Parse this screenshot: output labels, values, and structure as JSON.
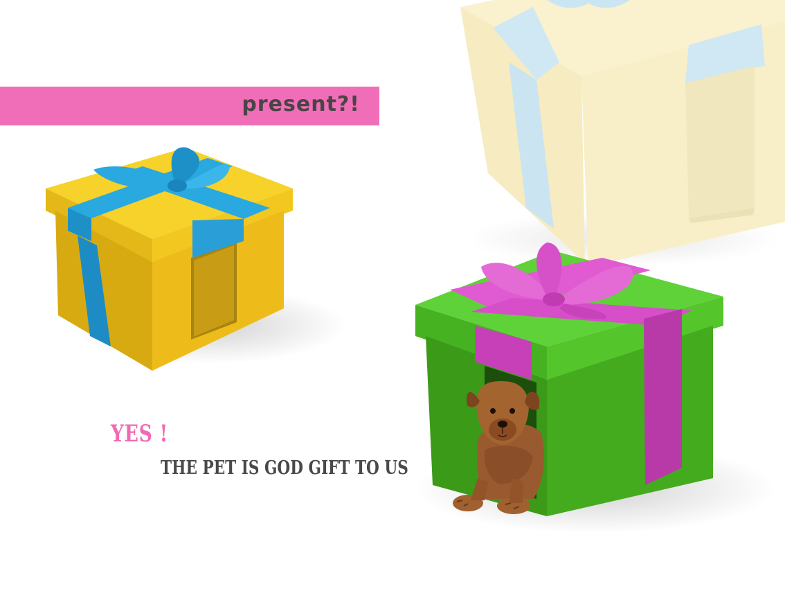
{
  "banner": {
    "text": "present?!",
    "color": "#f06eb8"
  },
  "headline": {
    "text": "YES !",
    "color": "#f16ab4"
  },
  "tagline": {
    "text": "THE PET IS GOD GIFT TO US",
    "color": "#4a4848"
  },
  "gift_boxes": [
    {
      "name": "yellow-gift-box",
      "box_color": "#f2c820",
      "ribbon_color": "#2aa8e0"
    },
    {
      "name": "green-gift-box",
      "box_color": "#44c41c",
      "ribbon_color": "#d64fc8"
    },
    {
      "name": "faded-gift-box",
      "box_color": "#f4e4a0",
      "ribbon_color": "#9fd2ea"
    }
  ],
  "pet": {
    "name": "puppy",
    "color": "#9a5a30"
  }
}
